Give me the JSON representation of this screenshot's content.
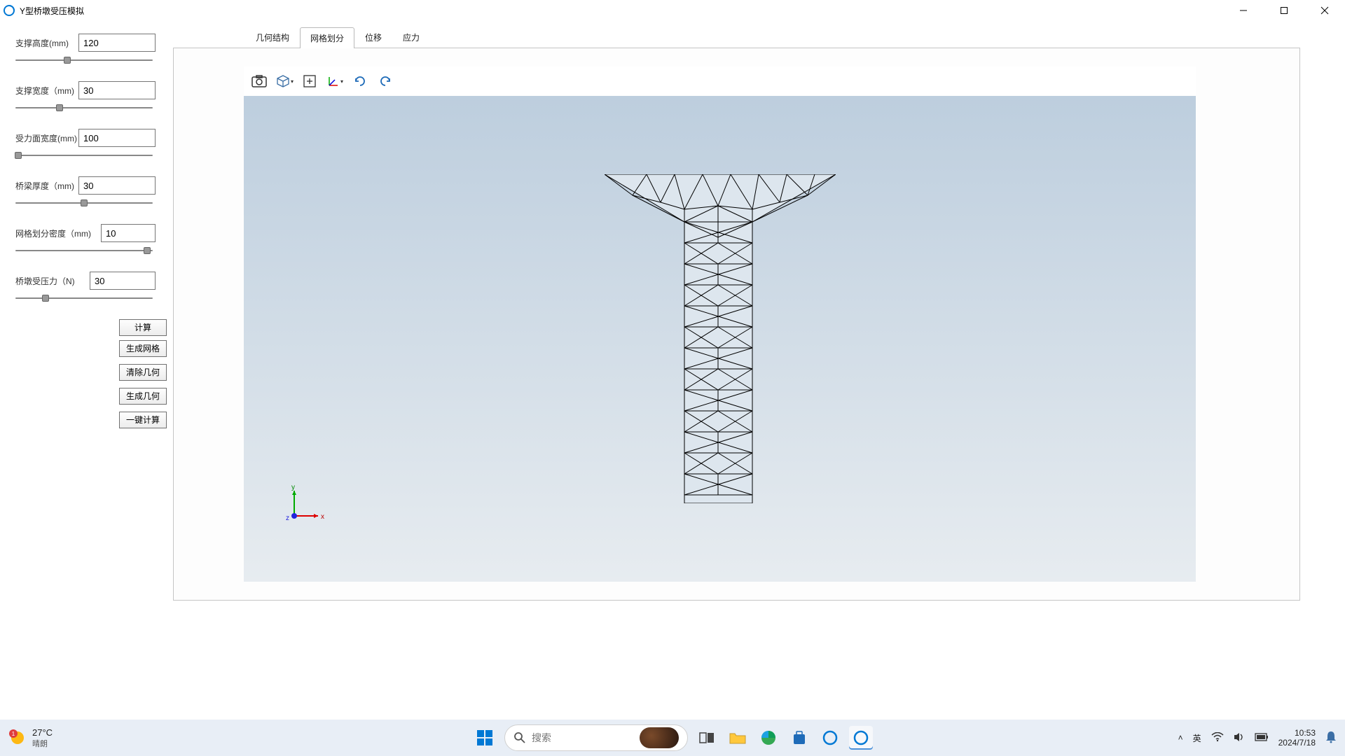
{
  "window": {
    "title": "Y型桥墩受压模拟"
  },
  "params": [
    {
      "label": "支撑高度(mm)",
      "value": "120",
      "slider_pct": 38
    },
    {
      "label": "支撑宽度（mm)",
      "value": "30",
      "slider_pct": 32
    },
    {
      "label": "受力面宽度(mm)",
      "value": "100",
      "slider_pct": 2
    },
    {
      "label": "桥梁厚度（mm)",
      "value": "30",
      "slider_pct": 50
    },
    {
      "label": "网格划分密度（mm)",
      "value": "10",
      "slider_pct": 96,
      "input_offset": true
    },
    {
      "label": "桥墩受压力（N)",
      "value": "30",
      "slider_pct": 22
    }
  ],
  "buttons": {
    "calculate": "计算",
    "gen_mesh": "生成网格",
    "clear_geom": "清除几何",
    "gen_geom": "生成几何",
    "one_key_calc": "一键计算"
  },
  "tabs": {
    "geometry": "几何结构",
    "mesh": "网格划分",
    "displacement": "位移",
    "stress": "应力"
  },
  "active_tab": "mesh",
  "axis": {
    "x": "x",
    "y": "y",
    "z": "z"
  },
  "taskbar": {
    "weather_temp": "27°C",
    "weather_desc": "晴朗",
    "weather_badge": "1",
    "search_placeholder": "搜索",
    "ime": "英",
    "time": "10:53",
    "date": "2024/7/18"
  },
  "tray_icons": [
    "chevron-up",
    "ime",
    "wifi",
    "volume",
    "battery",
    "clock",
    "notification"
  ]
}
